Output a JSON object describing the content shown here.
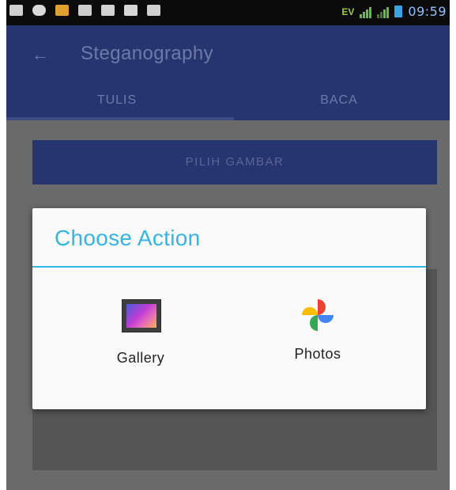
{
  "status_bar": {
    "time": "09:59",
    "network_label": "EV"
  },
  "app_bar": {
    "title": "Steganography"
  },
  "tabs": [
    {
      "label": "TULIS",
      "selected": true
    },
    {
      "label": "BACA",
      "selected": false
    }
  ],
  "main": {
    "pick_button_label": "PILIH GAMBAR"
  },
  "dialog": {
    "title": "Choose Action",
    "options": [
      {
        "label": "Gallery",
        "icon": "gallery-icon"
      },
      {
        "label": "Photos",
        "icon": "photos-icon"
      }
    ]
  },
  "colors": {
    "primary": "#263570",
    "dialog_accent": "#33b5e5",
    "status_time": "#8fc3ff"
  }
}
